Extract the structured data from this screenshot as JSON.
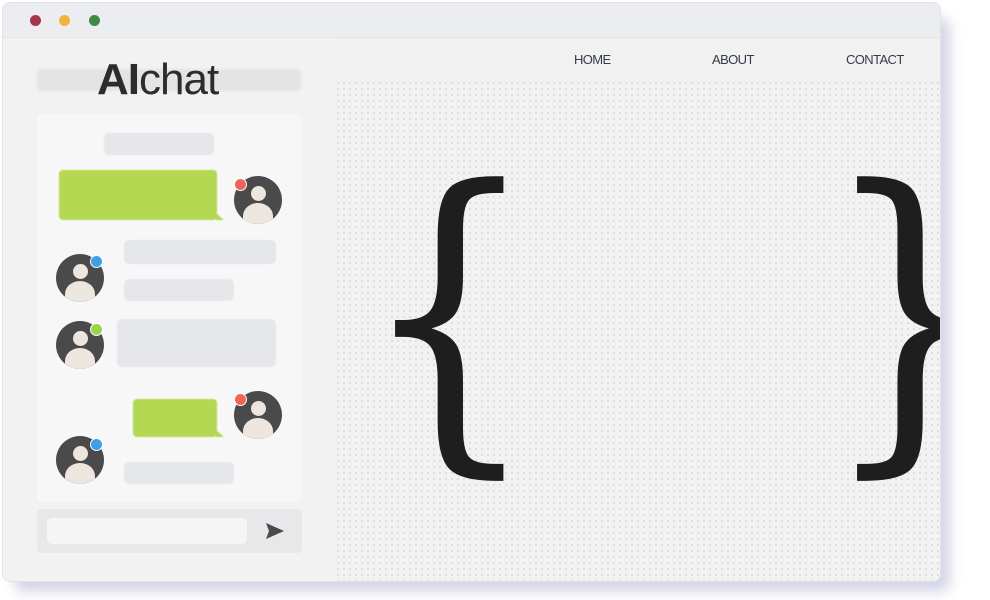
{
  "window": {
    "controls": [
      "close",
      "minimize",
      "maximize"
    ]
  },
  "logo": {
    "bold": "AI",
    "regular": "chat"
  },
  "nav": {
    "home": "HOME",
    "about": "ABOUT",
    "contact": "CONTACT"
  },
  "chat": {
    "status_colors": {
      "red": "#f0645a",
      "blue": "#3f9fe6",
      "green": "#9ed24a"
    },
    "accent_bubble": "#b4d852",
    "send_icon": "send-arrow-icon"
  },
  "hero": {
    "open_brace": "{",
    "close_brace": "}"
  },
  "colors": {
    "dot_close": "#a7364a",
    "dot_minimize": "#f0b43a",
    "dot_maximize": "#3f8a4a"
  }
}
